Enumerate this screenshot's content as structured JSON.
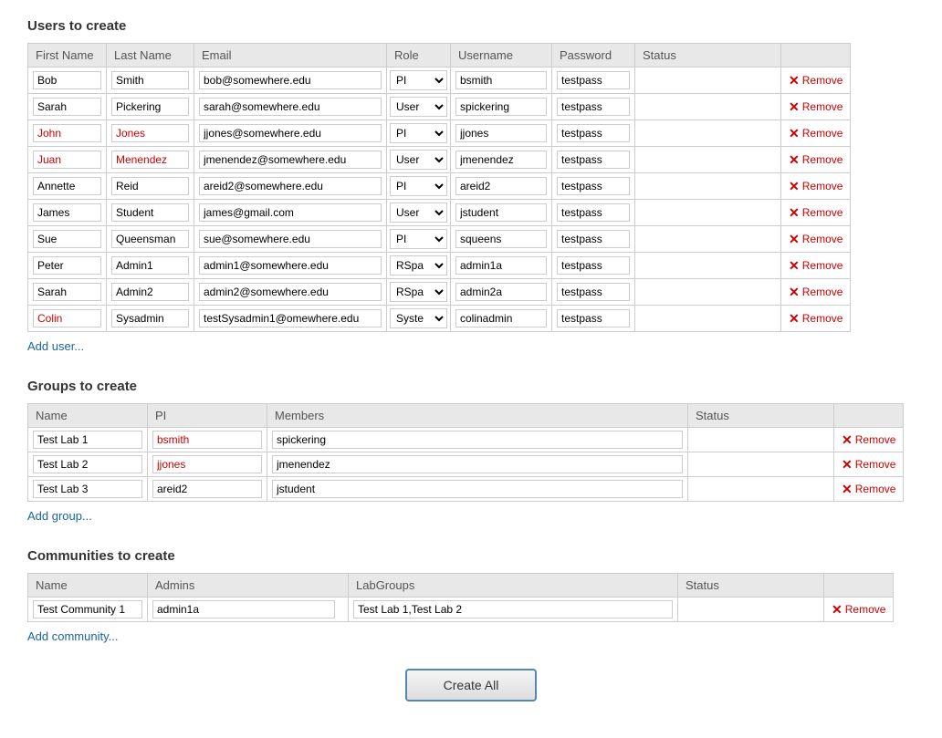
{
  "users_section": {
    "title": "Users to create",
    "columns": [
      "First Name",
      "Last Name",
      "Email",
      "Role",
      "Username",
      "Password",
      "Status"
    ],
    "users": [
      {
        "first": "Bob",
        "last": "Smith",
        "email": "bob@somewhere.edu",
        "role": "PI",
        "username": "bsmith",
        "password": "testpass",
        "first_red": false,
        "last_red": false
      },
      {
        "first": "Sarah",
        "last": "Pickering",
        "email": "sarah@somewhere.edu",
        "role": "User",
        "username": "spickering",
        "password": "testpass",
        "first_red": false,
        "last_red": false
      },
      {
        "first": "John",
        "last": "Jones",
        "email": "jjones@somewhere.edu",
        "role": "PI",
        "username": "jjones",
        "password": "testpass",
        "first_red": true,
        "last_red": true
      },
      {
        "first": "Juan",
        "last": "Menendez",
        "email": "jmenendez@somewhere.edu",
        "role": "User",
        "username": "jmenendez",
        "password": "testpass",
        "first_red": true,
        "last_red": true
      },
      {
        "first": "Annette",
        "last": "Reid",
        "email": "areid2@somewhere.edu",
        "role": "PI",
        "username": "areid2",
        "password": "testpass",
        "first_red": false,
        "last_red": false
      },
      {
        "first": "James",
        "last": "Student",
        "email": "james@gmail.com",
        "role": "User",
        "username": "jstudent",
        "password": "testpass",
        "first_red": false,
        "last_red": false
      },
      {
        "first": "Sue",
        "last": "Queensman",
        "email": "sue@somewhere.edu",
        "role": "PI",
        "username": "squeens",
        "password": "testpass",
        "first_red": false,
        "last_red": false
      },
      {
        "first": "Peter",
        "last": "Admin1",
        "email": "admin1@somewhere.edu",
        "role": "RSpa",
        "username": "admin1a",
        "password": "testpass",
        "first_red": false,
        "last_red": false
      },
      {
        "first": "Sarah",
        "last": "Admin2",
        "email": "admin2@somewhere.edu",
        "role": "RSpa",
        "username": "admin2a",
        "password": "testpass",
        "first_red": false,
        "last_red": false
      },
      {
        "first": "Colin",
        "last": "Sysadmin",
        "email": "testSysadmin1@omewhere.edu",
        "role": "Syste",
        "username": "colinadmin",
        "password": "testpass",
        "first_red": true,
        "last_red": false
      }
    ],
    "add_label": "Add user...",
    "remove_label": "Remove"
  },
  "groups_section": {
    "title": "Groups to create",
    "columns": [
      "Name",
      "PI",
      "Members",
      "Status"
    ],
    "groups": [
      {
        "name": "Test Lab 1",
        "pi": "bsmith",
        "members": "spickering",
        "pi_red": true
      },
      {
        "name": "Test Lab 2",
        "pi": "jjones",
        "members": "jmenendez",
        "pi_red": true
      },
      {
        "name": "Test Lab 3",
        "pi": "areid2",
        "members": "jstudent",
        "pi_red": false
      }
    ],
    "add_label": "Add group...",
    "remove_label": "Remove"
  },
  "communities_section": {
    "title": "Communities to create",
    "columns": [
      "Name",
      "Admins",
      "LabGroups",
      "Status"
    ],
    "communities": [
      {
        "name": "Test Community 1",
        "admins": "admin1a",
        "labgroups": "Test Lab 1,Test Lab 2"
      }
    ],
    "add_label": "Add community...",
    "remove_label": "Remove"
  },
  "create_btn_label": "Create All"
}
